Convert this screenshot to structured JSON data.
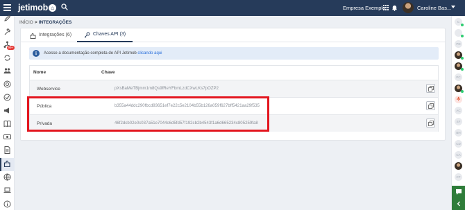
{
  "topbar": {
    "logo": "jetimob",
    "company": "Empresa Exemplo",
    "user_name": "Caroline Bas..."
  },
  "breadcrumb": {
    "home": "INÍCIO",
    "separator": ">",
    "current": "INTEGRAÇÕES"
  },
  "tabs": [
    {
      "label": "Integrações (6)",
      "icon": "plug-icon"
    },
    {
      "label": "Chaves API (3)",
      "icon": "key-icon"
    }
  ],
  "info": {
    "text": "Acesse a documentação completa de API Jetimob ",
    "link": "clicando aqui"
  },
  "table": {
    "headers": {
      "name": "Nome",
      "key": "Chave"
    },
    "rows": [
      {
        "name": "Webservice",
        "key": "pXsBaMeTBjmm1m8Qs9fReYFbmLzdCXwLKs7pOZP2"
      },
      {
        "name": "Pública",
        "key": "b355a44ddc290fbcd93651ef7e22c5e2104b55b126a059f627bff5421aa29f535"
      },
      {
        "name": "Privada",
        "key": "46f2dcb02e0c037a51e7044c6d5fd57f192cb2b4543f1a6d665234c805259fa8"
      }
    ]
  },
  "sidebar": {
    "badge": "99+"
  },
  "rightbar": {
    "avatars": [
      "C",
      "",
      "PD",
      "",
      "PC",
      "",
      "",
      "",
      "AC",
      "SF",
      "BH",
      "CD",
      "CA",
      "",
      "CT",
      "CV"
    ]
  },
  "colors": {
    "brand": "#263b5a",
    "highlight": "#e3161f",
    "link": "#2a6fdb"
  }
}
